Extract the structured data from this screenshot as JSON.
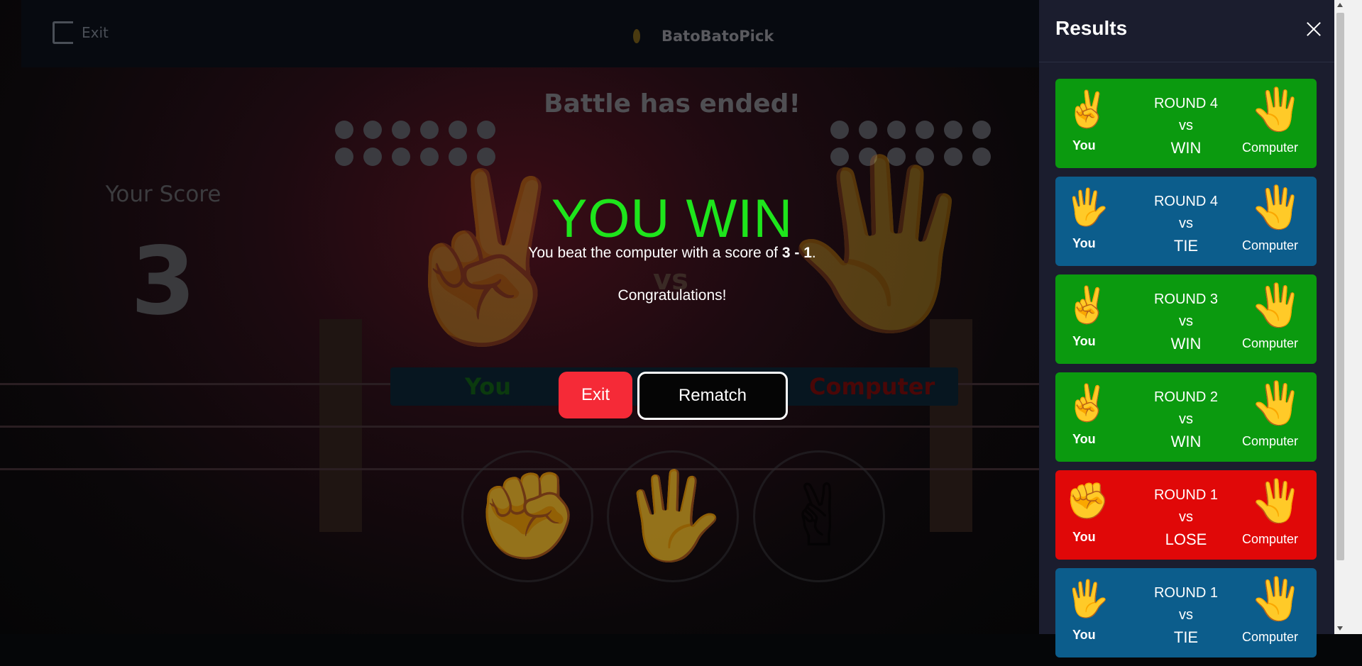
{
  "topbar": {
    "exit_label": "Exit",
    "brand_name": "BatoBatoPick"
  },
  "game": {
    "title": "Battle has ended!",
    "score_label": "Your Score",
    "score_value": "3",
    "vs": "vs",
    "you_label": "You",
    "computer_label": "Computer",
    "picks": [
      "rock",
      "paper",
      "scissors"
    ]
  },
  "modal": {
    "title": "YOU WIN",
    "message_prefix": "You beat the computer with a score of ",
    "score": "3 - 1",
    "message_suffix": ".",
    "congrats": "Congratulations!",
    "exit_label": "Exit",
    "rematch_label": "Rematch",
    "title_color": "#1ee51c"
  },
  "results": {
    "title": "Results",
    "rounds": [
      {
        "round": "ROUND 4",
        "vs": "vs",
        "result": "WIN",
        "you": "You",
        "computer": "Computer",
        "you_hand": "✌️",
        "computer_hand": "🖐️",
        "color": "#0b9a0f"
      },
      {
        "round": "ROUND 4",
        "vs": "vs",
        "result": "TIE",
        "you": "You",
        "computer": "Computer",
        "you_hand": "🖐️",
        "computer_hand": "🖐️",
        "color": "#0c5d8c"
      },
      {
        "round": "ROUND 3",
        "vs": "vs",
        "result": "WIN",
        "you": "You",
        "computer": "Computer",
        "you_hand": "✌️",
        "computer_hand": "🖐️",
        "color": "#0b9a0f"
      },
      {
        "round": "ROUND 2",
        "vs": "vs",
        "result": "WIN",
        "you": "You",
        "computer": "Computer",
        "you_hand": "✌️",
        "computer_hand": "🖐️",
        "color": "#0b9a0f"
      },
      {
        "round": "ROUND 1",
        "vs": "vs",
        "result": "LOSE",
        "you": "You",
        "computer": "Computer",
        "you_hand": "✊",
        "computer_hand": "🖐️",
        "color": "#e00808"
      },
      {
        "round": "ROUND 1",
        "vs": "vs",
        "result": "TIE",
        "you": "You",
        "computer": "Computer",
        "you_hand": "🖐️",
        "computer_hand": "🖐️",
        "color": "#0c5d8c"
      }
    ]
  }
}
